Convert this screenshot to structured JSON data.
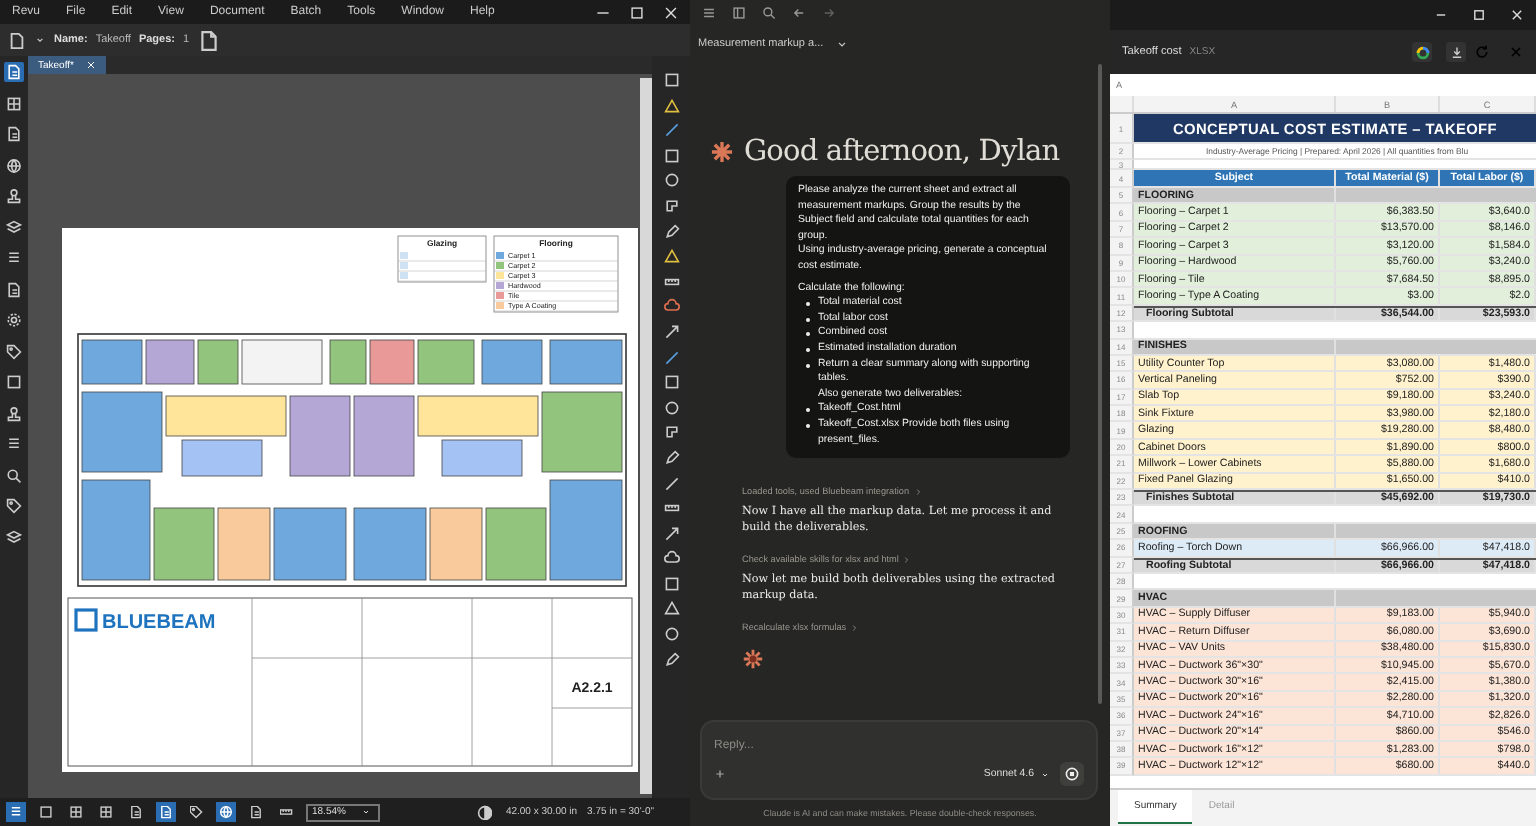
{
  "app": {
    "menu": [
      "Revu",
      "File",
      "Edit",
      "View",
      "Document",
      "Batch",
      "Tools",
      "Window",
      "Help"
    ],
    "toolbar": {
      "name_label": "Name:",
      "name_value": "Takeoff",
      "pages_label": "Pages:",
      "pages_value": "1"
    },
    "tools": [
      {
        "selected": true
      },
      {
        "selected": false
      },
      {
        "selected": false
      },
      {
        "selected": false
      },
      {
        "selected": false
      },
      {
        "selected": false
      },
      {
        "selected": false
      },
      {
        "selected": false
      },
      {
        "selected": false
      },
      {
        "selected": false
      },
      {
        "selected": false
      },
      {
        "selected": false
      },
      {
        "selected": false
      },
      {
        "selected": false
      },
      {
        "selected": false
      },
      {
        "selected": false
      }
    ],
    "tabs": [
      {
        "label": "Takeoff*",
        "selected": true
      }
    ],
    "drawing": {
      "legend": [
        {
          "title": "Glazing"
        },
        {
          "title": "Flooring",
          "items": [
            "Carpet 1",
            "Carpet 2",
            "Carpet 3",
            "Hardwood",
            "Tile",
            "Type A Coating"
          ]
        }
      ],
      "logo": "BLUEBEAM",
      "sheet_number": "A2.2.1"
    },
    "status": {
      "tools": [
        {
          "on": true
        },
        {
          "on": false
        },
        {
          "on": false
        },
        {
          "on": false
        },
        {
          "on": false
        },
        {
          "on": true
        },
        {
          "on": false
        },
        {
          "on": true
        },
        {
          "on": false
        },
        {
          "on": false
        }
      ],
      "zoom": "18.54%",
      "size": "42.00 x 30.00 in",
      "scale": "3.75 in = 30'-0\""
    }
  },
  "chat": {
    "title": "Measurement markup a...",
    "greeting": "Good afternoon, Dylan",
    "prompt": {
      "paragraphs": [
        "Please analyze the current sheet and extract all measurement markups. Group the results by the Subject field and calculate total quantities for each group.",
        "Using industry-average pricing, generate a conceptual cost estimate."
      ],
      "lead": "Calculate the following:",
      "bullets": [
        "Total material cost",
        "Total labor cost",
        "Combined cost",
        "Estimated installation duration",
        "Return a clear summary along with supporting tables.\nAlso generate two deliverables:",
        "Takeoff_Cost.html",
        "Takeoff_Cost.xlsx Provide both files using present_files."
      ]
    },
    "steps": [
      {
        "kind": "tool",
        "text": "Loaded tools, used Bluebeam integration"
      },
      {
        "kind": "reply",
        "text": "Now I have all the markup data. Let me process it and build the deliverables."
      },
      {
        "kind": "tool",
        "text": "Check available skills for xlsx and html"
      },
      {
        "kind": "reply",
        "text": "Now let me build both deliverables using the extracted markup data."
      },
      {
        "kind": "tool",
        "text": "Recalculate xlsx formulas"
      }
    ],
    "composer": {
      "placeholder": "Reply...",
      "model": "Sonnet 4.6"
    },
    "disclaimer": "Claude is AI and can make mistakes. Please double-check responses."
  },
  "sheet": {
    "title": "Takeoff cost",
    "format": "XLSX",
    "cell_ref": "A",
    "columns": [
      "A",
      "B",
      "C"
    ],
    "rows": [
      {
        "n": "1",
        "kind": "title",
        "cells": [
          "CONCEPTUAL COST ESTIMATE – TAKEOFF"
        ]
      },
      {
        "n": "2",
        "kind": "subtitle",
        "cells": [
          "Industry-Average Pricing  |  Prepared: April 2026  |  All quantities from Blu"
        ]
      },
      {
        "n": "3",
        "kind": "blank",
        "cells": []
      },
      {
        "n": "4",
        "kind": "header",
        "cells": [
          "Subject",
          "Total Material ($)",
          "Total Labor ($)"
        ]
      },
      {
        "n": "5",
        "kind": "section",
        "cells": [
          "FLOORING"
        ]
      },
      {
        "n": "6",
        "kind": "item",
        "color": "#e2efda",
        "cells": [
          "Flooring – Carpet 1",
          "$6,383.50",
          "$3,640.0"
        ]
      },
      {
        "n": "7",
        "kind": "item",
        "color": "#e2efda",
        "cells": [
          "Flooring – Carpet 2",
          "$13,570.00",
          "$8,146.0"
        ]
      },
      {
        "n": "8",
        "kind": "item",
        "color": "#e2efda",
        "cells": [
          "Flooring – Carpet 3",
          "$3,120.00",
          "$1,584.0"
        ]
      },
      {
        "n": "9",
        "kind": "item",
        "color": "#e2efda",
        "cells": [
          "Flooring – Hardwood",
          "$5,760.00",
          "$3,240.0"
        ]
      },
      {
        "n": "10",
        "kind": "item",
        "color": "#e2efda",
        "cells": [
          "Flooring – Tile",
          "$7,684.50",
          "$8,895.0"
        ]
      },
      {
        "n": "11",
        "kind": "item",
        "color": "#e2efda",
        "cells": [
          "Flooring – Type A Coating",
          "$3.00",
          "$2.0"
        ]
      },
      {
        "n": "12",
        "kind": "subtotal",
        "cells": [
          "Flooring Subtotal",
          "$36,544.00",
          "$23,593.0"
        ]
      },
      {
        "n": "13",
        "kind": "blank",
        "cells": []
      },
      {
        "n": "14",
        "kind": "section",
        "cells": [
          "FINISHES"
        ]
      },
      {
        "n": "15",
        "kind": "item",
        "color": "#fff2cc",
        "cells": [
          "Utility Counter Top",
          "$3,080.00",
          "$1,480.0"
        ]
      },
      {
        "n": "16",
        "kind": "item",
        "color": "#fff2cc",
        "cells": [
          "Vertical Paneling",
          "$752.00",
          "$390.0"
        ]
      },
      {
        "n": "17",
        "kind": "item",
        "color": "#fff2cc",
        "cells": [
          "Slab Top",
          "$9,180.00",
          "$3,240.0"
        ]
      },
      {
        "n": "18",
        "kind": "item",
        "color": "#fff2cc",
        "cells": [
          "Sink Fixture",
          "$3,980.00",
          "$2,180.0"
        ]
      },
      {
        "n": "19",
        "kind": "item",
        "color": "#fff2cc",
        "cells": [
          "Glazing",
          "$19,280.00",
          "$8,480.0"
        ]
      },
      {
        "n": "20",
        "kind": "item",
        "color": "#fff2cc",
        "cells": [
          "Cabinet Doors",
          "$1,890.00",
          "$800.0"
        ]
      },
      {
        "n": "21",
        "kind": "item",
        "color": "#fff2cc",
        "cells": [
          "Millwork – Lower Cabinets",
          "$5,880.00",
          "$1,680.0"
        ]
      },
      {
        "n": "22",
        "kind": "item",
        "color": "#fff2cc",
        "cells": [
          "Fixed Panel Glazing",
          "$1,650.00",
          "$410.0"
        ]
      },
      {
        "n": "23",
        "kind": "subtotal",
        "cells": [
          "Finishes Subtotal",
          "$45,692.00",
          "$19,730.0"
        ]
      },
      {
        "n": "24",
        "kind": "blank",
        "cells": []
      },
      {
        "n": "25",
        "kind": "section",
        "cells": [
          "ROOFING"
        ]
      },
      {
        "n": "26",
        "kind": "item",
        "color": "#ddebf7",
        "cells": [
          "Roofing – Torch Down",
          "$66,966.00",
          "$47,418.0"
        ]
      },
      {
        "n": "27",
        "kind": "subtotal",
        "cells": [
          "Roofing Subtotal",
          "$66,966.00",
          "$47,418.0"
        ]
      },
      {
        "n": "28",
        "kind": "blank",
        "cells": []
      },
      {
        "n": "29",
        "kind": "section",
        "cells": [
          "HVAC"
        ]
      },
      {
        "n": "30",
        "kind": "item",
        "color": "#fce4d6",
        "cells": [
          "HVAC – Supply Diffuser",
          "$9,183.00",
          "$5,940.0"
        ]
      },
      {
        "n": "31",
        "kind": "item",
        "color": "#fce4d6",
        "cells": [
          "HVAC – Return Diffuser",
          "$6,080.00",
          "$3,690.0"
        ]
      },
      {
        "n": "32",
        "kind": "item",
        "color": "#fce4d6",
        "cells": [
          "HVAC – VAV Units",
          "$38,480.00",
          "$15,830.0"
        ]
      },
      {
        "n": "33",
        "kind": "item",
        "color": "#fce4d6",
        "cells": [
          "HVAC – Ductwork 36\"×30\"",
          "$10,945.00",
          "$5,670.0"
        ]
      },
      {
        "n": "34",
        "kind": "item",
        "color": "#fce4d6",
        "cells": [
          "HVAC – Ductwork 30\"×16\"",
          "$2,415.00",
          "$1,380.0"
        ]
      },
      {
        "n": "35",
        "kind": "item",
        "color": "#fce4d6",
        "cells": [
          "HVAC – Ductwork 20\"×16\"",
          "$2,280.00",
          "$1,320.0"
        ]
      },
      {
        "n": "36",
        "kind": "item",
        "color": "#fce4d6",
        "cells": [
          "HVAC – Ductwork 24\"×16\"",
          "$4,710.00",
          "$2,826.0"
        ]
      },
      {
        "n": "37",
        "kind": "item",
        "color": "#fce4d6",
        "cells": [
          "HVAC – Ductwork 20\"×14\"",
          "$860.00",
          "$546.0"
        ]
      },
      {
        "n": "38",
        "kind": "item",
        "color": "#fce4d6",
        "cells": [
          "HVAC – Ductwork 16\"×12\"",
          "$1,283.00",
          "$798.0"
        ]
      },
      {
        "n": "39",
        "kind": "item",
        "color": "#fce4d6",
        "cells": [
          "HVAC – Ductwork 12\"×12\"",
          "$680.00",
          "$440.0"
        ]
      }
    ],
    "tabs": [
      {
        "label": "Summary",
        "selected": true
      },
      {
        "label": "Detail",
        "selected": false
      }
    ]
  }
}
